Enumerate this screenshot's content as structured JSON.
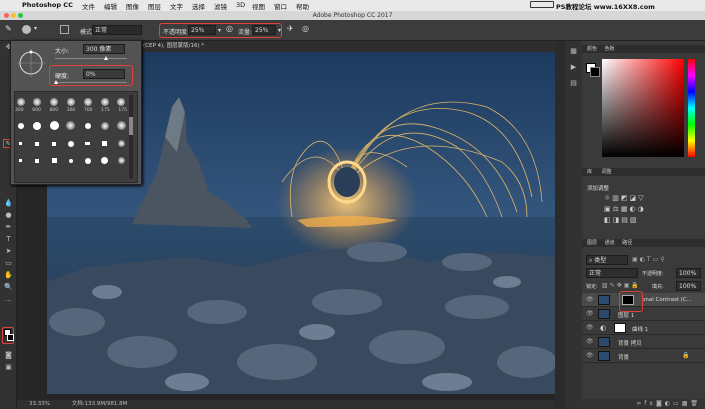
{
  "menubar": {
    "apple": "",
    "app": "Photoshop CC",
    "items": [
      "文件",
      "编辑",
      "图像",
      "图层",
      "文字",
      "选择",
      "滤镜",
      "3D",
      "视图",
      "窗口",
      "帮助"
    ],
    "watermark": "PS教程论坛 www.16XX8.com"
  },
  "window": {
    "title": "Adobe Photoshop CC 2017"
  },
  "options": {
    "mode_label": "模式:",
    "mode_value": "正常",
    "opacity_label": "不透明度:",
    "opacity_value": "25%",
    "flow_label": "流量:",
    "flow_value": "25%"
  },
  "tab": {
    "label": "(CEP 4), 图层蒙版/16) *"
  },
  "brush_popup": {
    "size_label": "大小:",
    "size_value": "300 像素",
    "hardness_label": "硬度:",
    "hardness_value": "0%",
    "preset_sizes": [
      "300",
      "600",
      "800",
      "300",
      "700",
      "175",
      "175"
    ]
  },
  "status": {
    "zoom": "33.33%",
    "doc": "文档:133.9M/981.8M"
  },
  "panels": {
    "color_tabs": [
      "颜色",
      "色板"
    ],
    "lib_tabs": [
      "库",
      "调整"
    ],
    "adjust_title": "添加调整",
    "layers_tabs": [
      "图层",
      "通道",
      "路径"
    ],
    "kind_label": "类型",
    "blend_value": "正常",
    "opacity_label": "不透明度:",
    "opacity_value": "100%",
    "lock_label": "锁定:",
    "fill_label": "填充:",
    "fill_value": "100%",
    "layers": [
      {
        "name": "onal Contrast (C..."
      },
      {
        "name": "图层 1"
      },
      {
        "name": "曲线 1"
      },
      {
        "name": "背景 拷贝"
      },
      {
        "name": "背景"
      }
    ]
  },
  "colors": {
    "highlight": "#e0413a",
    "panel": "#3a3a3a"
  }
}
